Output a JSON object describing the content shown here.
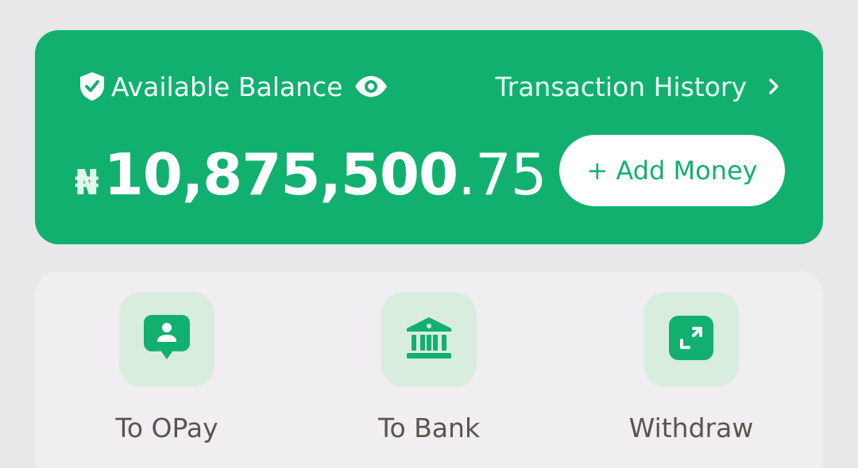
{
  "balance": {
    "label": "Available Balance",
    "currency_symbol": "₦",
    "amount_main": "10,875,500",
    "amount_decimal": ".75",
    "shield_icon": "shield-check-icon",
    "eye_icon": "eye-icon"
  },
  "history": {
    "label": "Transaction History",
    "chevron_icon": "chevron-right-icon"
  },
  "add_money": {
    "label": "+ Add Money"
  },
  "actions": [
    {
      "label": "To OPay",
      "icon": "person-chat-icon"
    },
    {
      "label": "To Bank",
      "icon": "bank-icon"
    },
    {
      "label": "Withdraw",
      "icon": "expand-arrows-icon"
    }
  ],
  "colors": {
    "brand_green": "#12b06f",
    "tile_green": "#d9eddf",
    "page_bg": "#e9e7ea",
    "panel_bg": "#f0eef1",
    "label_text": "#5b544f"
  }
}
